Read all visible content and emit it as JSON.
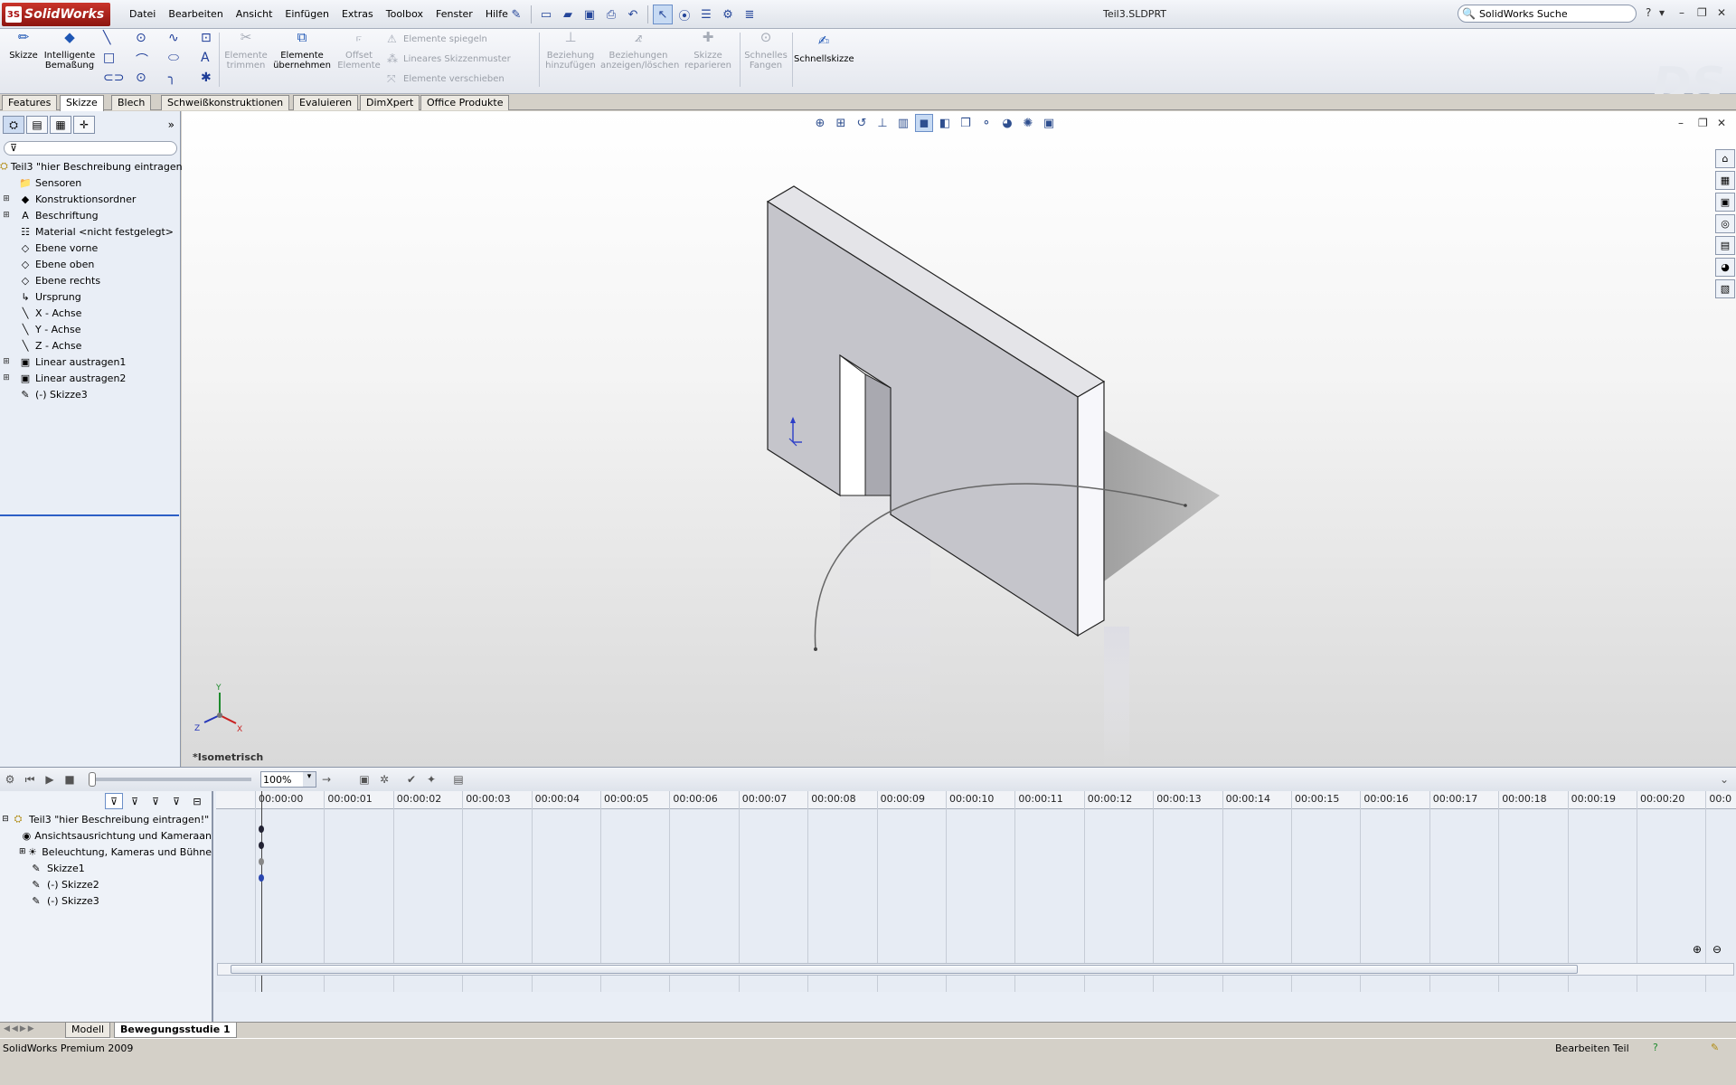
{
  "app": {
    "logo_text": "SolidWorks",
    "document_title": "Teil3.SLDPRT",
    "search_placeholder": "SolidWorks Suche",
    "menu": [
      "Datei",
      "Bearbeiten",
      "Ansicht",
      "Einfügen",
      "Extras",
      "Toolbox",
      "Fenster",
      "Hilfe"
    ]
  },
  "commands": {
    "skizze": "Skizze",
    "bemassung_l1": "Intelligente",
    "bemassung_l2": "Bemaßung",
    "trimmen_l1": "Elemente",
    "trimmen_l2": "trimmen",
    "uebernehmen_l1": "Elemente",
    "uebernehmen_l2": "übernehmen",
    "offset_l1": "Offset",
    "offset_l2": "Elemente",
    "spiegeln": "Elemente spiegeln",
    "muster": "Lineares Skizzenmuster",
    "verschieben": "Elemente verschieben",
    "beziehung_l1": "Beziehung",
    "beziehung_l2": "hinzufügen",
    "anzeigen_l1": "Beziehungen",
    "anzeigen_l2": "anzeigen/löschen",
    "reparieren_l1": "Skizze",
    "reparieren_l2": "reparieren",
    "fangen_l1": "Schnelles",
    "fangen_l2": "Fangen",
    "schnellskizze": "Schnellskizze"
  },
  "tabs": [
    "Features",
    "Skizze",
    "Blech",
    "Schweißkonstruktionen",
    "Evaluieren",
    "DimXpert",
    "Office Produkte"
  ],
  "active_tab": "Skizze",
  "feature_tree": {
    "root": "Teil3 \"hier Beschreibung eintragen!\"",
    "items": [
      {
        "label": "Sensoren",
        "expandable": false
      },
      {
        "label": "Konstruktionsordner",
        "expandable": true
      },
      {
        "label": "Beschriftung",
        "expandable": true
      },
      {
        "label": "Material <nicht festgelegt>",
        "expandable": false
      },
      {
        "label": "Ebene vorne",
        "expandable": false
      },
      {
        "label": "Ebene oben",
        "expandable": false
      },
      {
        "label": "Ebene rechts",
        "expandable": false
      },
      {
        "label": "Ursprung",
        "expandable": false
      },
      {
        "label": "X - Achse",
        "expandable": false
      },
      {
        "label": "Y - Achse",
        "expandable": false
      },
      {
        "label": "Z - Achse",
        "expandable": false
      },
      {
        "label": "Linear austragen1",
        "expandable": true
      },
      {
        "label": "Linear austragen2",
        "expandable": true
      },
      {
        "label": "(-) Skizze3",
        "expandable": false
      }
    ]
  },
  "viewport": {
    "view_label": "*Isometrisch",
    "triad": {
      "x": "X",
      "y": "Y",
      "z": "Z"
    }
  },
  "motion": {
    "zoom": "100%",
    "tree_root": "Teil3 \"hier Beschreibung eintragen!\"",
    "tree_items": [
      {
        "label": "Ansichtsausrichtung und Kameraan",
        "expandable": false
      },
      {
        "label": "Beleuchtung, Kameras und Bühne",
        "expandable": true
      },
      {
        "label": "Skizze1",
        "expandable": false
      },
      {
        "label": "(-) Skizze2",
        "expandable": false
      },
      {
        "label": "(-) Skizze3",
        "expandable": false
      }
    ],
    "timeline_ticks": [
      "00:00:00",
      "00:00:01",
      "00:00:02",
      "00:00:03",
      "00:00:04",
      "00:00:05",
      "00:00:06",
      "00:00:07",
      "00:00:08",
      "00:00:09",
      "00:00:10",
      "00:00:11",
      "00:00:12",
      "00:00:13",
      "00:00:14",
      "00:00:15",
      "00:00:16",
      "00:00:17",
      "00:00:18",
      "00:00:19",
      "00:00:20",
      "00:0"
    ],
    "study_tabs": [
      "Modell",
      "Bewegungsstudie 1"
    ],
    "active_study": "Bewegungsstudie 1"
  },
  "status": {
    "left": "SolidWorks Premium 2009",
    "right": "Bearbeiten Teil"
  }
}
